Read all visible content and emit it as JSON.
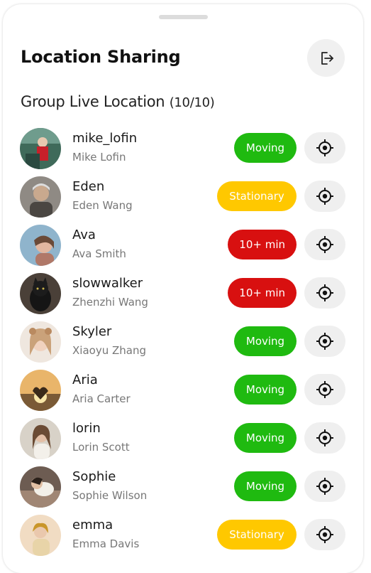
{
  "header": {
    "title": "Location Sharing",
    "exit_icon": "logout-icon"
  },
  "section": {
    "title": "Group Live Location",
    "count": "(10/10)"
  },
  "colors": {
    "moving": "#1fba10",
    "stationary": "#ffc800",
    "late": "#d81010"
  },
  "members": [
    {
      "username": "mike_lofin",
      "full_name": "Mike Lofin",
      "status": "Moving",
      "status_type": "moving",
      "avatar": "avatar-photo-mike"
    },
    {
      "username": "Eden",
      "full_name": "Eden Wang",
      "status": "Stationary",
      "status_type": "stationary",
      "avatar": "avatar-photo-eden"
    },
    {
      "username": "Ava",
      "full_name": "Ava Smith",
      "status": "10+ min",
      "status_type": "late",
      "avatar": "avatar-photo-ava"
    },
    {
      "username": "slowwalker",
      "full_name": "Zhenzhi Wang",
      "status": "10+ min",
      "status_type": "late",
      "avatar": "avatar-photo-cat"
    },
    {
      "username": "Skyler",
      "full_name": "Xiaoyu Zhang",
      "status": "Moving",
      "status_type": "moving",
      "avatar": "avatar-photo-skyler"
    },
    {
      "username": "Aria",
      "full_name": "Aria Carter",
      "status": "Moving",
      "status_type": "moving",
      "avatar": "avatar-photo-aria"
    },
    {
      "username": "lorin",
      "full_name": "Lorin Scott",
      "status": "Moving",
      "status_type": "moving",
      "avatar": "avatar-photo-lorin"
    },
    {
      "username": "Sophie",
      "full_name": "Sophie Wilson",
      "status": "Moving",
      "status_type": "moving",
      "avatar": "avatar-photo-sophie"
    },
    {
      "username": "emma",
      "full_name": "Emma Davis",
      "status": "Stationary",
      "status_type": "stationary",
      "avatar": "avatar-photo-emma"
    }
  ]
}
